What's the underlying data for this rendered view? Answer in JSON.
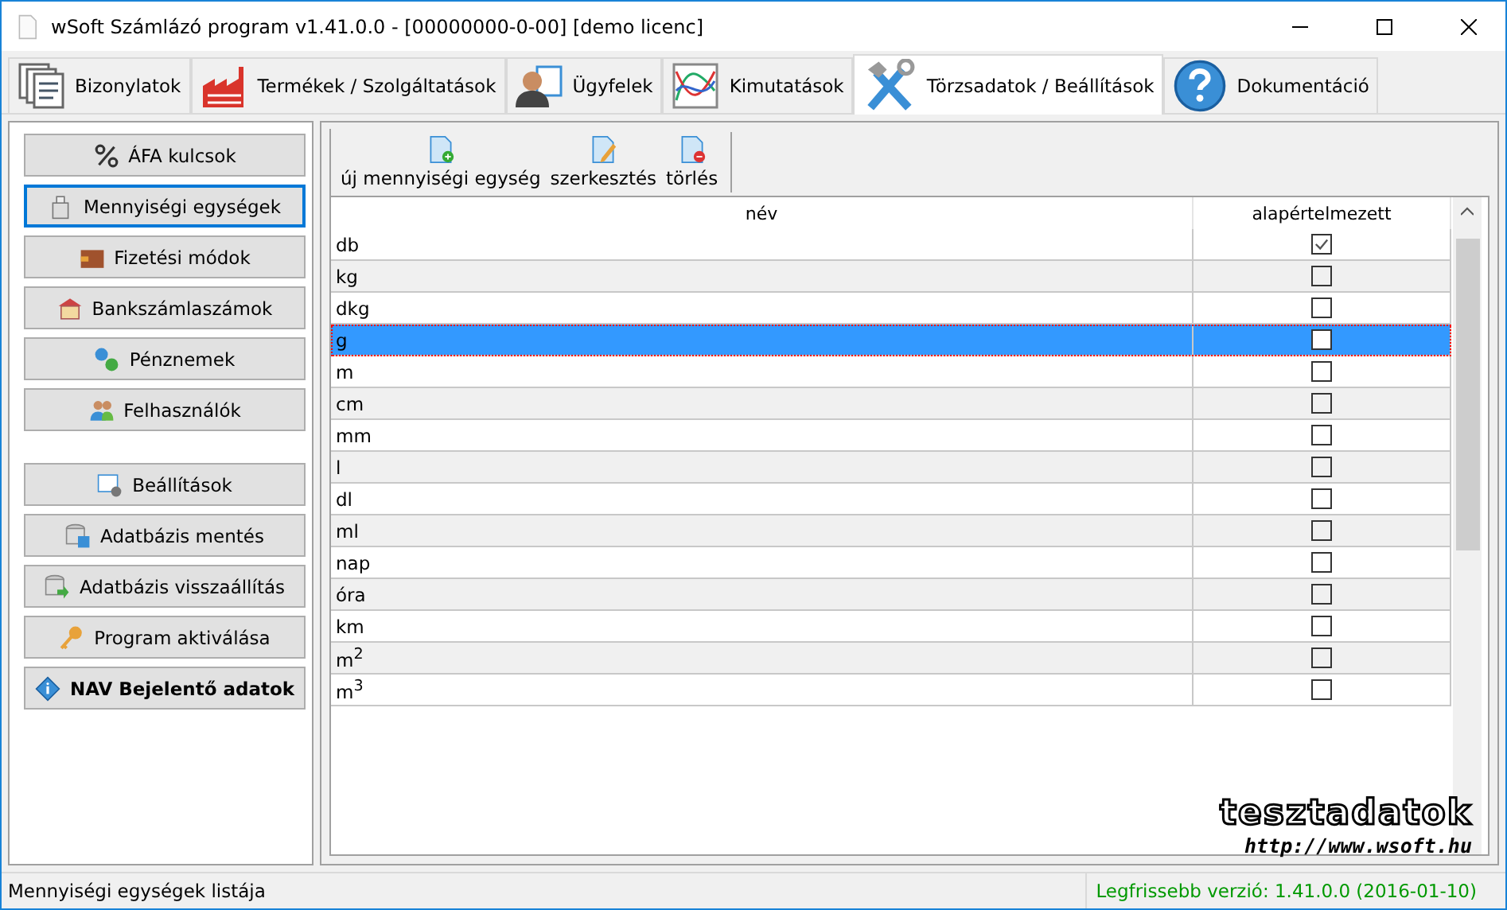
{
  "window": {
    "title": "wSoft Számlázó program v1.41.0.0 - [00000000-0-00] [demo licenc]"
  },
  "tabs": [
    {
      "label": "Bizonylatok",
      "selected": false
    },
    {
      "label": "Termékek / Szolgáltatások",
      "selected": false
    },
    {
      "label": "Ügyfelek",
      "selected": false
    },
    {
      "label": "Kimutatások",
      "selected": false
    },
    {
      "label": "Törzsadatok / Beállítások",
      "selected": true
    },
    {
      "label": "Dokumentáció",
      "selected": false
    }
  ],
  "sidebar": {
    "groups": [
      [
        {
          "label": "ÁFA kulcsok",
          "selected": false,
          "bold": false
        },
        {
          "label": "Mennyiségi egységek",
          "selected": true,
          "bold": false
        },
        {
          "label": "Fizetési módok",
          "selected": false,
          "bold": false
        },
        {
          "label": "Bankszámlaszámok",
          "selected": false,
          "bold": false
        },
        {
          "label": "Pénznemek",
          "selected": false,
          "bold": false
        },
        {
          "label": "Felhasználók",
          "selected": false,
          "bold": false
        }
      ],
      [
        {
          "label": "Beállítások",
          "selected": false,
          "bold": false
        },
        {
          "label": "Adatbázis mentés",
          "selected": false,
          "bold": false
        },
        {
          "label": "Adatbázis visszaállítás",
          "selected": false,
          "bold": false
        },
        {
          "label": "Program aktiválása",
          "selected": false,
          "bold": false
        },
        {
          "label": "NAV Bejelentő adatok",
          "selected": false,
          "bold": true
        }
      ]
    ]
  },
  "toolbar": [
    {
      "label": "új mennyiségi egység",
      "kind": "add"
    },
    {
      "label": "szerkesztés",
      "kind": "edit"
    },
    {
      "label": "törlés",
      "kind": "delete"
    }
  ],
  "table": {
    "columns": [
      "név",
      "alapértelmezett"
    ],
    "rows": [
      {
        "name": "db",
        "default": true,
        "selected": false
      },
      {
        "name": "kg",
        "default": false,
        "selected": false
      },
      {
        "name": "dkg",
        "default": false,
        "selected": false
      },
      {
        "name": "g",
        "default": false,
        "selected": true
      },
      {
        "name": "m",
        "default": false,
        "selected": false
      },
      {
        "name": "cm",
        "default": false,
        "selected": false
      },
      {
        "name": "mm",
        "default": false,
        "selected": false
      },
      {
        "name": "l",
        "default": false,
        "selected": false
      },
      {
        "name": "dl",
        "default": false,
        "selected": false
      },
      {
        "name": "ml",
        "default": false,
        "selected": false
      },
      {
        "name": "nap",
        "default": false,
        "selected": false
      },
      {
        "name": "óra",
        "default": false,
        "selected": false
      },
      {
        "name": "km",
        "default": false,
        "selected": false
      },
      {
        "name": "m$^{2}$",
        "default": false,
        "selected": false
      },
      {
        "name": "m$^{3}$",
        "default": false,
        "selected": false
      }
    ]
  },
  "stamp": {
    "title": "tesztadatok",
    "url": "http://www.wsoft.hu"
  },
  "status_bar": {
    "left": "Mennyiségi egységek listája",
    "right": "Legfrissebb verzió: 1.41.0.0 (2016-01-10)"
  }
}
